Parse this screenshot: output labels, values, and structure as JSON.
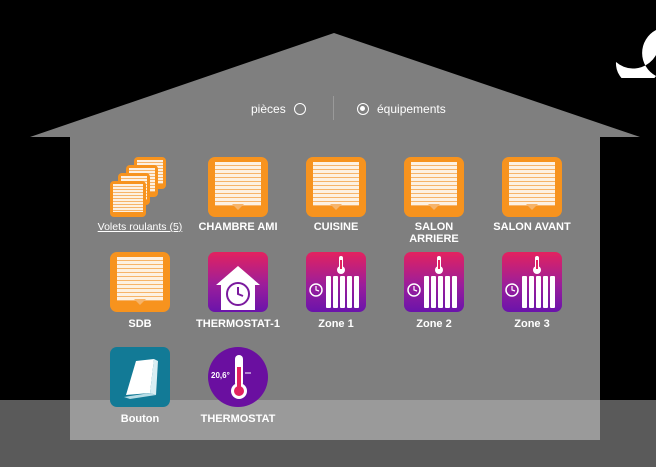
{
  "toggle": {
    "rooms_label": "pièces",
    "devices_label": "équipements",
    "selected": "équipements"
  },
  "colors": {
    "shutter": "#f7931e",
    "heating_top": "#e3225f",
    "heating_bottom": "#6a14ab",
    "button": "#127a96",
    "thermostat": "#6a0fa0"
  },
  "tiles": [
    {
      "label": "Volets roulants (5)",
      "icon": "shutter-group-icon"
    },
    {
      "label": "CHAMBRE AMI",
      "icon": "roller-shutter-icon"
    },
    {
      "label": "CUISINE",
      "icon": "roller-shutter-icon"
    },
    {
      "label": "SALON ARRIERE",
      "icon": "roller-shutter-icon"
    },
    {
      "label": "SALON AVANT",
      "icon": "roller-shutter-icon"
    },
    {
      "label": "SDB",
      "icon": "roller-shutter-icon"
    },
    {
      "label": "THERMOSTAT-1",
      "icon": "house-clock-icon"
    },
    {
      "label": "Zone 1",
      "icon": "radiator-clock-icon"
    },
    {
      "label": "Zone 2",
      "icon": "radiator-clock-icon"
    },
    {
      "label": "Zone 3",
      "icon": "radiator-clock-icon"
    },
    {
      "label": "Bouton",
      "icon": "switch-button-icon"
    },
    {
      "label": "THERMOSTAT",
      "icon": "thermometer-icon",
      "reading": "20,6°"
    }
  ]
}
